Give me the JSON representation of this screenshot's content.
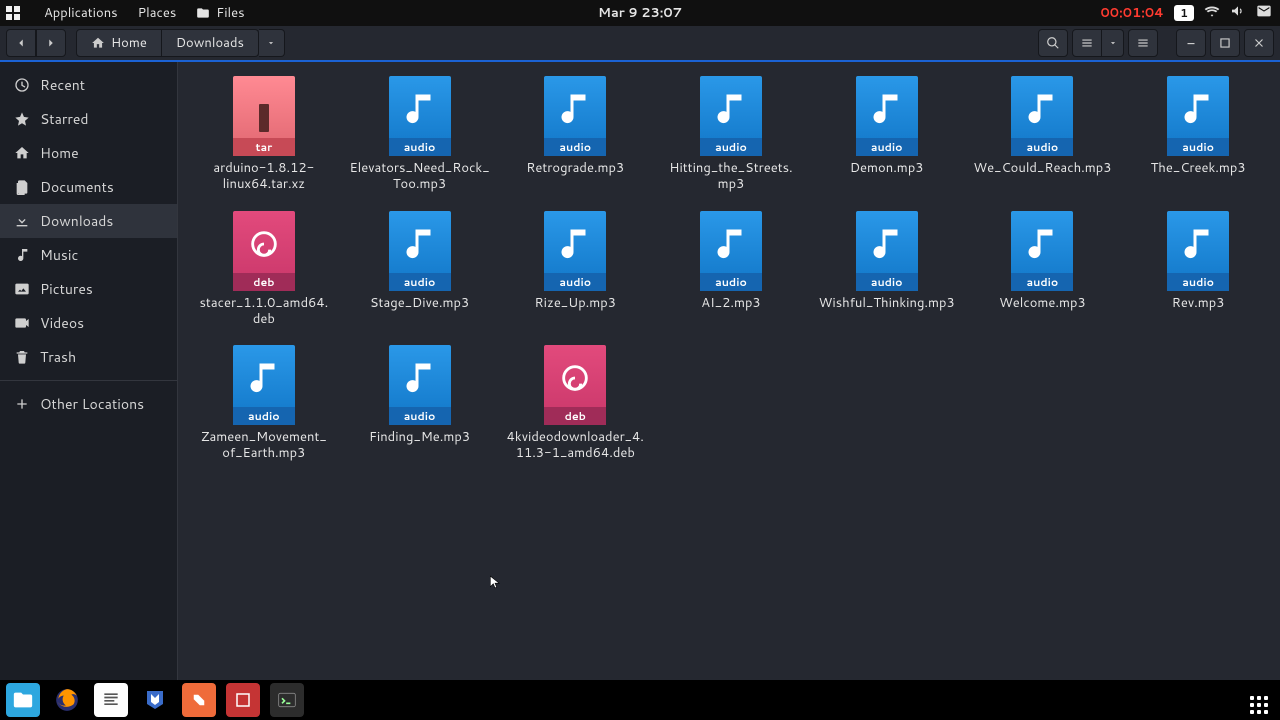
{
  "panel": {
    "menus": {
      "applications": "Applications",
      "places": "Places",
      "files": "Files"
    },
    "clock": "Mar 9  23:07",
    "recording_timer": "00:01:04",
    "workspace_indicator": "1"
  },
  "toolbar": {
    "path": {
      "home": "Home",
      "downloads": "Downloads"
    }
  },
  "sidebar": {
    "items": [
      {
        "key": "recent",
        "label": "Recent",
        "icon": "clock-icon"
      },
      {
        "key": "starred",
        "label": "Starred",
        "icon": "star-icon"
      },
      {
        "key": "home",
        "label": "Home",
        "icon": "home-icon"
      },
      {
        "key": "documents",
        "label": "Documents",
        "icon": "documents-icon"
      },
      {
        "key": "downloads",
        "label": "Downloads",
        "icon": "download-icon",
        "active": true
      },
      {
        "key": "music",
        "label": "Music",
        "icon": "music-icon"
      },
      {
        "key": "pictures",
        "label": "Pictures",
        "icon": "pictures-icon"
      },
      {
        "key": "videos",
        "label": "Videos",
        "icon": "videos-icon"
      },
      {
        "key": "trash",
        "label": "Trash",
        "icon": "trash-icon"
      }
    ],
    "other_locations": "Other Locations"
  },
  "file_type_badges": {
    "audio": "audio",
    "tar": "tar",
    "deb": "deb"
  },
  "files": [
    {
      "name": "arduino-1.8.12-linux64.tar.xz",
      "kind": "tar"
    },
    {
      "name": "Elevators_Need_Rock_Too.mp3",
      "kind": "audio"
    },
    {
      "name": "Retrograde.mp3",
      "kind": "audio"
    },
    {
      "name": "Hitting_the_Streets.mp3",
      "kind": "audio"
    },
    {
      "name": "Demon.mp3",
      "kind": "audio"
    },
    {
      "name": "We_Could_Reach.mp3",
      "kind": "audio"
    },
    {
      "name": "The_Creek.mp3",
      "kind": "audio"
    },
    {
      "name": "stacer_1.1.0_amd64.deb",
      "kind": "deb"
    },
    {
      "name": "Stage_Dive.mp3",
      "kind": "audio"
    },
    {
      "name": "Rize_Up.mp3",
      "kind": "audio"
    },
    {
      "name": "AI_2.mp3",
      "kind": "audio"
    },
    {
      "name": "Wishful_Thinking.mp3",
      "kind": "audio"
    },
    {
      "name": "Welcome.mp3",
      "kind": "audio"
    },
    {
      "name": "Rev.mp3",
      "kind": "audio"
    },
    {
      "name": "Zameen_Movement_of_Earth.mp3",
      "kind": "audio"
    },
    {
      "name": "Finding_Me.mp3",
      "kind": "audio"
    },
    {
      "name": "4kvideodownloader_4.11.3-1_amd64.deb",
      "kind": "deb"
    }
  ],
  "colors": {
    "accent": "#1b62d4",
    "audio_icon": "#2a98e8",
    "deb_icon": "#c9376a",
    "tar_icon": "#e06670"
  }
}
